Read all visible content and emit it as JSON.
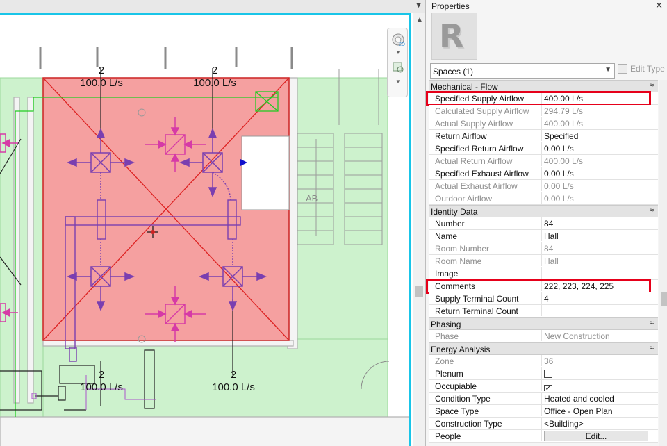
{
  "canvas": {
    "labels": [
      {
        "count": "2",
        "flow": "100.0 L/s"
      },
      {
        "count": "2",
        "flow": "100.0 L/s"
      },
      {
        "count": "2",
        "flow": "100.0 L/s"
      },
      {
        "count": "2",
        "flow": "100.0 L/s"
      }
    ],
    "stair_tag": "AB",
    "nav_bar": {
      "icons": [
        "2d-steering-wheel-icon",
        "zoom-region-icon"
      ]
    }
  },
  "properties": {
    "title": "Properties",
    "type_selector": "Spaces (1)",
    "edit_type_label": "Edit Type",
    "groups": [
      {
        "name": "Mechanical - Flow",
        "rows": [
          {
            "name": "Specified Supply Airflow",
            "value": "400.00 L/s",
            "readonly": false,
            "highlight": true
          },
          {
            "name": "Calculated Supply Airflow",
            "value": "294.79 L/s",
            "readonly": true
          },
          {
            "name": "Actual Supply Airflow",
            "value": "400.00 L/s",
            "readonly": true
          },
          {
            "name": "Return Airflow",
            "value": "Specified",
            "readonly": false
          },
          {
            "name": "Specified Return Airflow",
            "value": "0.00 L/s",
            "readonly": false
          },
          {
            "name": "Actual Return Airflow",
            "value": "400.00 L/s",
            "readonly": true
          },
          {
            "name": "Specified Exhaust Airflow",
            "value": "0.00 L/s",
            "readonly": false
          },
          {
            "name": "Actual Exhaust Airflow",
            "value": "0.00 L/s",
            "readonly": true
          },
          {
            "name": "Outdoor Airflow",
            "value": "0.00 L/s",
            "readonly": true
          }
        ]
      },
      {
        "name": "Identity Data",
        "rows": [
          {
            "name": "Number",
            "value": "84",
            "readonly": false
          },
          {
            "name": "Name",
            "value": "Hall",
            "readonly": false
          },
          {
            "name": "Room Number",
            "value": "84",
            "readonly": true
          },
          {
            "name": "Room Name",
            "value": "Hall",
            "readonly": true
          },
          {
            "name": "Image",
            "value": "",
            "readonly": false
          },
          {
            "name": "Comments",
            "value": "222, 223, 224, 225",
            "readonly": false,
            "highlight": true
          },
          {
            "name": "Supply Terminal Count",
            "value": "4",
            "readonly": false
          },
          {
            "name": "Return Terminal Count",
            "value": "",
            "readonly": false
          }
        ]
      },
      {
        "name": "Phasing",
        "rows": [
          {
            "name": "Phase",
            "value": "New Construction",
            "readonly": true
          }
        ]
      },
      {
        "name": "Energy Analysis",
        "rows": [
          {
            "name": "Zone",
            "value": "36",
            "readonly": true
          },
          {
            "name": "Plenum",
            "value": "",
            "checkbox": true,
            "checked": false
          },
          {
            "name": "Occupiable",
            "value": "",
            "checkbox": true,
            "checked": true
          },
          {
            "name": "Condition Type",
            "value": "Heated and cooled",
            "readonly": false
          },
          {
            "name": "Space Type",
            "value": "Office - Open Plan",
            "readonly": false
          },
          {
            "name": "Construction Type",
            "value": "<Building>",
            "readonly": false
          },
          {
            "name": "People",
            "value": "Edit...",
            "button": true
          }
        ]
      }
    ]
  }
}
